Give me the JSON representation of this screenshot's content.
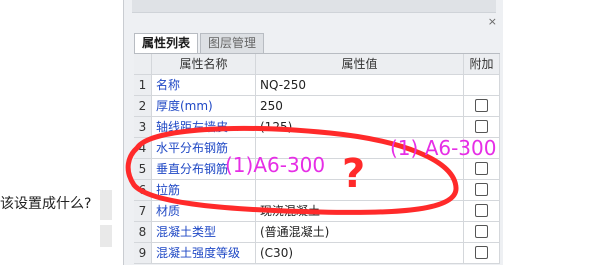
{
  "left_question": "该设置成什么?",
  "panel": {
    "close_glyph": "×",
    "tabs": [
      {
        "label": "属性列表",
        "active": true
      },
      {
        "label": "图层管理",
        "active": false
      }
    ],
    "columns": [
      "",
      "属性名称",
      "属性值",
      "附加"
    ],
    "rows": [
      {
        "num": "1",
        "name": "名称",
        "value": "NQ-250",
        "checkbox": false
      },
      {
        "num": "2",
        "name": "厚度(mm)",
        "value": "250",
        "checkbox": true
      },
      {
        "num": "3",
        "name": "轴线距左墙皮...",
        "value": "(125)",
        "checkbox": true
      },
      {
        "num": "4",
        "name": "水平分布钢筋",
        "value": "",
        "checkbox": false
      },
      {
        "num": "5",
        "name": "垂直分布钢筋",
        "value": "",
        "checkbox": true
      },
      {
        "num": "6",
        "name": "拉筋",
        "value": "",
        "checkbox": true
      },
      {
        "num": "7",
        "name": "材质",
        "value": "现浇混凝土",
        "checkbox": true
      },
      {
        "num": "8",
        "name": "混凝土类型",
        "value": "(普通混凝土)",
        "checkbox": true
      },
      {
        "num": "9",
        "name": "混凝土强度等级",
        "value": "(C30)",
        "checkbox": true
      }
    ]
  },
  "annotations": {
    "text_left": "(1)A6-300",
    "text_right": "(1)  A6-300",
    "question_mark": "?",
    "color_text": "#e62ee6",
    "color_mark": "#ff2a2a"
  }
}
